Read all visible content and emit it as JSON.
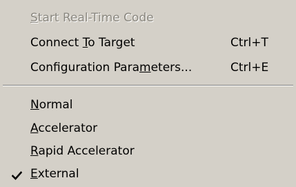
{
  "menu": {
    "items": [
      {
        "label": "Start Real-Time Code",
        "mnemonic": "S",
        "enabled": false,
        "checked": false,
        "shortcut": ""
      },
      {
        "label": "Connect To Target",
        "mnemonic": "T",
        "enabled": true,
        "checked": false,
        "shortcut": "Ctrl+T"
      },
      {
        "label": "Configuration Parameters...",
        "mnemonic": "m",
        "enabled": true,
        "checked": false,
        "shortcut": "Ctrl+E"
      },
      {
        "label": "Normal",
        "mnemonic": "N",
        "enabled": true,
        "checked": false,
        "shortcut": ""
      },
      {
        "label": "Accelerator",
        "mnemonic": "A",
        "enabled": true,
        "checked": false,
        "shortcut": ""
      },
      {
        "label": "Rapid Accelerator",
        "mnemonic": "R",
        "enabled": true,
        "checked": false,
        "shortcut": ""
      },
      {
        "label": "External",
        "mnemonic": "E",
        "enabled": true,
        "checked": true,
        "shortcut": ""
      }
    ],
    "colors": {
      "background": "#d4d0c8",
      "text": "#000000",
      "disabled_text": "#8a877f",
      "separator_dark": "#808080",
      "separator_light": "#ffffff"
    },
    "icons": {
      "check": "checkmark-icon"
    }
  }
}
